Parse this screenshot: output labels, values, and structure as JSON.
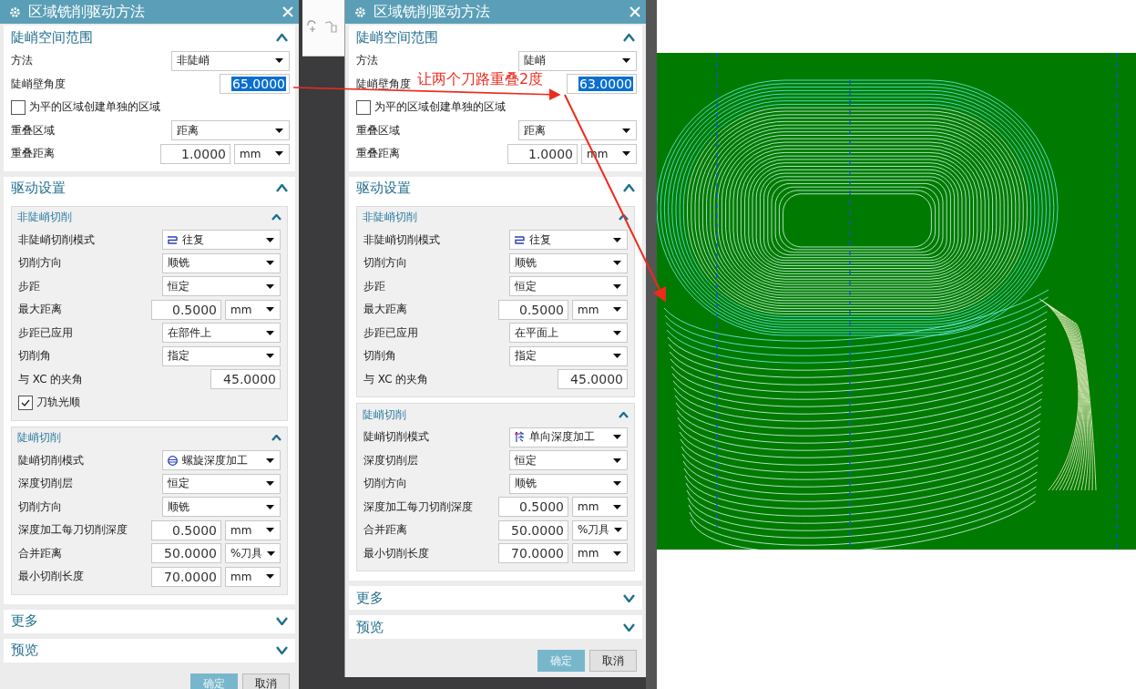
{
  "dialogs": [
    {
      "title": "区域铣削驱动方法",
      "sections": [
        {
          "title": "陡峭空间范围",
          "expanded": true,
          "rows": [
            {
              "kind": "select",
              "label": "方法",
              "value": "非陡峭"
            },
            {
              "kind": "number",
              "label": "陡峭壁角度",
              "value": "65.0000",
              "highlighted": true
            },
            {
              "kind": "checkbox",
              "label": "为平的区域创建单独的区域",
              "checked": false
            },
            {
              "kind": "select",
              "label": "重叠区域",
              "value": "距离"
            },
            {
              "kind": "number_unit",
              "label": "重叠距离",
              "value": "1.0000",
              "unit": "mm",
              "highlighted": false
            }
          ]
        },
        {
          "title": "驱动设置",
          "expanded": true,
          "groups": [
            {
              "title": "非陡峭切削",
              "expanded": true,
              "rows": [
                {
                  "kind": "zigzag",
                  "label": "非陡峭切削模式",
                  "value": "往复"
                },
                {
                  "kind": "select",
                  "label": "切削方向",
                  "value": "顺铣"
                },
                {
                  "kind": "select",
                  "label": "步距",
                  "value": "恒定"
                },
                {
                  "kind": "number_unit",
                  "label": "最大距离",
                  "value": "0.5000",
                  "unit": "mm",
                  "highlighted": false
                },
                {
                  "kind": "select",
                  "label": "步距已应用",
                  "value": "在部件上"
                },
                {
                  "kind": "select",
                  "label": "切削角",
                  "value": "指定"
                },
                {
                  "kind": "number",
                  "label": "与 XC 的夹角",
                  "value": "45.0000",
                  "highlighted": false
                },
                {
                  "kind": "checkbox",
                  "label": "刀轨光顺",
                  "checked": true
                }
              ]
            },
            {
              "title": "陡峭切削",
              "expanded": true,
              "rows": [
                {
                  "kind": "spiral",
                  "label": "陡峭切削模式",
                  "value": "螺旋深度加工"
                },
                {
                  "kind": "select",
                  "label": "深度切削层",
                  "value": "恒定"
                },
                {
                  "kind": "select",
                  "label": "切削方向",
                  "value": "顺铣"
                },
                {
                  "kind": "number_unit",
                  "label": "深度加工每刀切削深度",
                  "value": "0.5000",
                  "unit": "mm",
                  "highlighted": false
                },
                {
                  "kind": "number_unit",
                  "label": "合并距离",
                  "value": "50.0000",
                  "unit": "%刀具",
                  "highlighted": false
                },
                {
                  "kind": "number_unit",
                  "label": "最小切削长度",
                  "value": "70.0000",
                  "unit": "mm",
                  "highlighted": false
                }
              ]
            }
          ]
        },
        {
          "title": "更多",
          "expanded": false
        },
        {
          "title": "预览",
          "expanded": false
        }
      ],
      "buttons": [
        {
          "label": "确定",
          "kind": "primary"
        },
        {
          "label": "取消",
          "kind": "secondary"
        }
      ]
    },
    {
      "title": "区域铣削驱动方法",
      "sections": [
        {
          "title": "陡峭空间范围",
          "expanded": true,
          "rows": [
            {
              "kind": "select",
              "label": "方法",
              "value": "陡峭"
            },
            {
              "kind": "number",
              "label": "陡峭壁角度",
              "value": "63.0000",
              "highlighted": true
            },
            {
              "kind": "checkbox",
              "label": "为平的区域创建单独的区域",
              "checked": false
            },
            {
              "kind": "select",
              "label": "重叠区域",
              "value": "距离"
            },
            {
              "kind": "number_unit",
              "label": "重叠距离",
              "value": "1.0000",
              "unit": "mm",
              "highlighted": false
            }
          ]
        },
        {
          "title": "驱动设置",
          "expanded": true,
          "groups": [
            {
              "title": "非陡峭切削",
              "expanded": true,
              "rows": [
                {
                  "kind": "zigzag",
                  "label": "非陡峭切削模式",
                  "value": "往复"
                },
                {
                  "kind": "select",
                  "label": "切削方向",
                  "value": "顺铣"
                },
                {
                  "kind": "select",
                  "label": "步距",
                  "value": "恒定"
                },
                {
                  "kind": "number_unit",
                  "label": "最大距离",
                  "value": "0.5000",
                  "unit": "mm",
                  "highlighted": false
                },
                {
                  "kind": "select",
                  "label": "步距已应用",
                  "value": "在平面上"
                },
                {
                  "kind": "select",
                  "label": "切削角",
                  "value": "指定"
                },
                {
                  "kind": "number",
                  "label": "与 XC 的夹角",
                  "value": "45.0000",
                  "highlighted": false
                }
              ]
            },
            {
              "title": "陡峭切削",
              "expanded": true,
              "rows": [
                {
                  "kind": "oneway",
                  "label": "陡峭切削模式",
                  "value": "单向深度加工"
                },
                {
                  "kind": "select",
                  "label": "深度切削层",
                  "value": "恒定"
                },
                {
                  "kind": "select",
                  "label": "切削方向",
                  "value": "顺铣"
                },
                {
                  "kind": "number_unit",
                  "label": "深度加工每刀切削深度",
                  "value": "0.5000",
                  "unit": "mm",
                  "highlighted": false
                },
                {
                  "kind": "number_unit",
                  "label": "合并距离",
                  "value": "50.0000",
                  "unit": "%刀具",
                  "highlighted": false
                },
                {
                  "kind": "number_unit",
                  "label": "最小切削长度",
                  "value": "70.0000",
                  "unit": "mm",
                  "highlighted": false
                }
              ]
            }
          ]
        },
        {
          "title": "更多",
          "expanded": false
        },
        {
          "title": "预览",
          "expanded": false
        }
      ],
      "buttons": [
        {
          "label": "确定",
          "kind": "primary"
        },
        {
          "label": "取消",
          "kind": "secondary"
        }
      ]
    }
  ],
  "annotation": {
    "text": "让两个刀路重叠2度"
  }
}
